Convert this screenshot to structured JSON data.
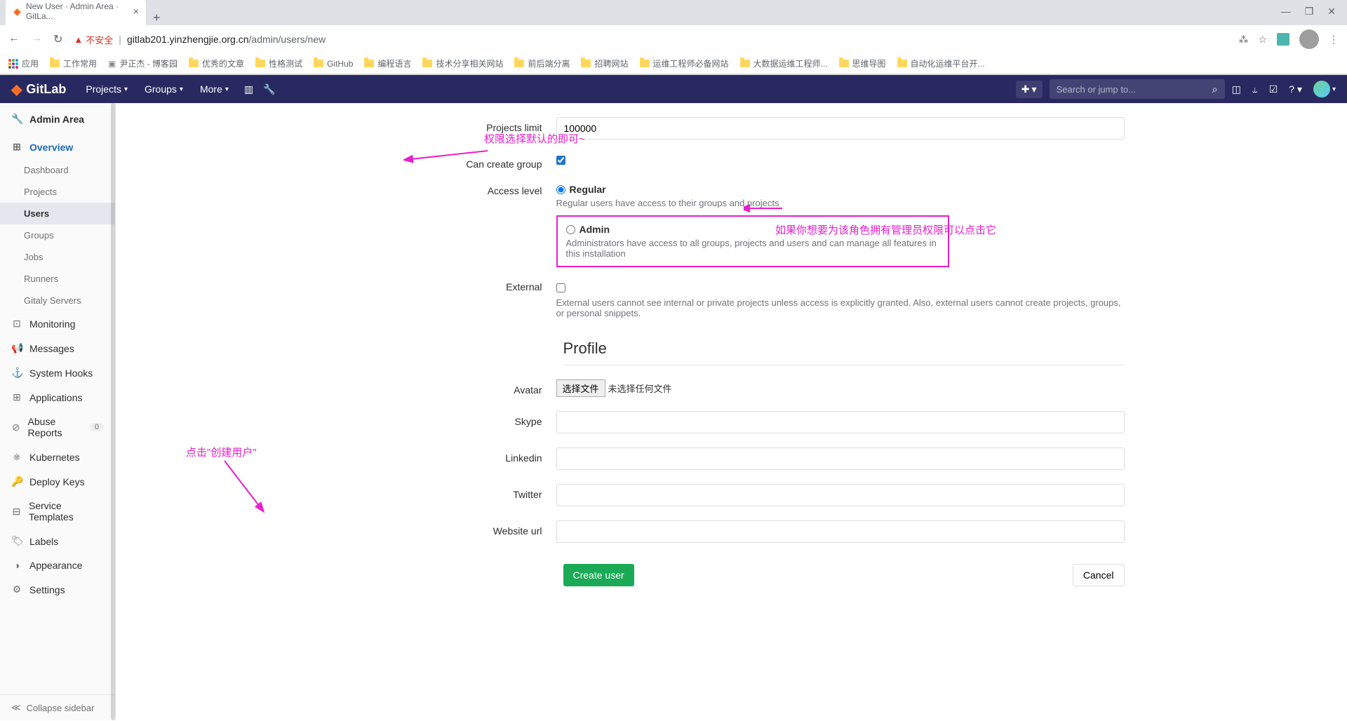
{
  "browser": {
    "tab_title": "New User · Admin Area · GitLa...",
    "insecure_label": "不安全",
    "url_host": "gitlab201.yinzhengjie.org.cn",
    "url_path": "/admin/users/new"
  },
  "bookmarks": [
    "应用",
    "工作常用",
    "尹正杰 - 博客园",
    "优秀的文章",
    "性格测试",
    "GitHub",
    "编程语言",
    "技术分享相关网站",
    "前后端分离",
    "招聘网站",
    "运维工程师必备网站",
    "大数据运维工程师...",
    "思维导图",
    "自动化运维平台开..."
  ],
  "navbar": {
    "brand": "GitLab",
    "projects": "Projects",
    "groups": "Groups",
    "more": "More",
    "search_placeholder": "Search or jump to..."
  },
  "sidebar": {
    "header": "Admin Area",
    "overview": "Overview",
    "dashboard": "Dashboard",
    "projects": "Projects",
    "users": "Users",
    "groups": "Groups",
    "jobs": "Jobs",
    "runners": "Runners",
    "gitaly": "Gitaly Servers",
    "monitoring": "Monitoring",
    "messages": "Messages",
    "system_hooks": "System Hooks",
    "applications": "Applications",
    "abuse_reports": "Abuse Reports",
    "abuse_count": "0",
    "kubernetes": "Kubernetes",
    "deploy_keys": "Deploy Keys",
    "service_templates": "Service Templates",
    "labels": "Labels",
    "appearance": "Appearance",
    "settings": "Settings",
    "collapse": "Collapse sidebar"
  },
  "form": {
    "projects_limit_label": "Projects limit",
    "projects_limit_value": "100000",
    "can_create_group_label": "Can create group",
    "access_level_label": "Access level",
    "regular_label": "Regular",
    "regular_help": "Regular users have access to their groups and projects",
    "admin_label": "Admin",
    "admin_help": "Administrators have access to all groups, projects and users and can manage all features in this installation",
    "external_label": "External",
    "external_help": "External users cannot see internal or private projects unless access is explicitly granted. Also, external users cannot create projects, groups, or personal snippets.",
    "profile_section": "Profile",
    "avatar_label": "Avatar",
    "file_btn": "选择文件",
    "file_text": "未选择任何文件",
    "skype_label": "Skype",
    "linkedin_label": "Linkedin",
    "twitter_label": "Twitter",
    "website_label": "Website url",
    "create_btn": "Create user",
    "cancel_btn": "Cancel"
  },
  "annotations": {
    "a1": "权限选择默认的即可~",
    "a2": "如果你想要为该角色拥有管理员权限可以点击它",
    "a3": "点击\"创建用户\""
  }
}
